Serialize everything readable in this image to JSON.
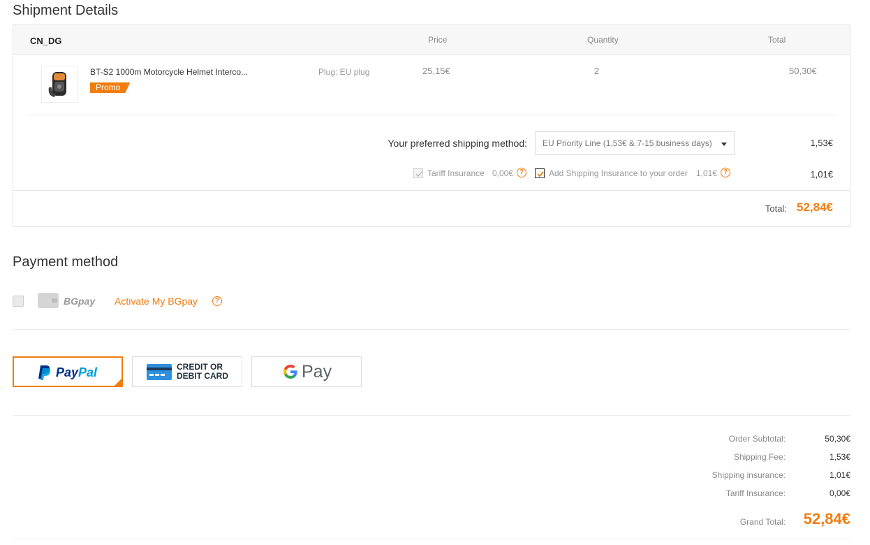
{
  "shipment": {
    "title": "Shipment Details",
    "warehouse": "CN_DG",
    "headers": {
      "price": "Price",
      "quantity": "Quantity",
      "total": "Total"
    },
    "item": {
      "name": "BT-S2 1000m Motorcycle Helmet Interco...",
      "promo": "Promo",
      "attribute": "Plug: EU plug",
      "price": "25,15€",
      "quantity": "2",
      "total": "50,30€"
    },
    "shipping_label": "Your preferred shipping method:",
    "shipping_method": "EU Priority Line (1,53€ & 7-15 business days)",
    "shipping_fee": "1,53€",
    "tariff_label": "Tariff Insurance",
    "tariff_value": "0,00€",
    "tariff_checked": true,
    "insurance_label": "Add Shipping Insurance to your order",
    "insurance_value": "1,01€",
    "insurance_checked": true,
    "insurance_fee": "1,01€",
    "total_label": "Total:",
    "total_value": "52,84€"
  },
  "payment": {
    "title": "Payment method",
    "bgpay_name": "BGpay",
    "bgpay_link": "Activate My BGpay",
    "methods": [
      {
        "label": "PayPal",
        "selected": true
      },
      {
        "label": "CREDIT OR DEBIT CARD",
        "line1": "CREDIT OR",
        "line2": "DEBIT CARD",
        "selected": false
      },
      {
        "label": "G Pay",
        "text": "Pay",
        "selected": false
      }
    ]
  },
  "summary": {
    "rows": [
      {
        "label": "Order Subtotal:",
        "value": "50,30€"
      },
      {
        "label": "Shipping Fee:",
        "value": "1,53€"
      },
      {
        "label": "Shipping insurance:",
        "value": "1,01€"
      },
      {
        "label": "Tariff Insurance:",
        "value": "0,00€"
      }
    ],
    "grand_label": "Grand Total:",
    "grand_value": "52,84€"
  },
  "colors": {
    "accent": "#f07d10",
    "paypal_dark": "#003087",
    "paypal_light": "#009cde",
    "card_blue": "#2d8fdd"
  }
}
